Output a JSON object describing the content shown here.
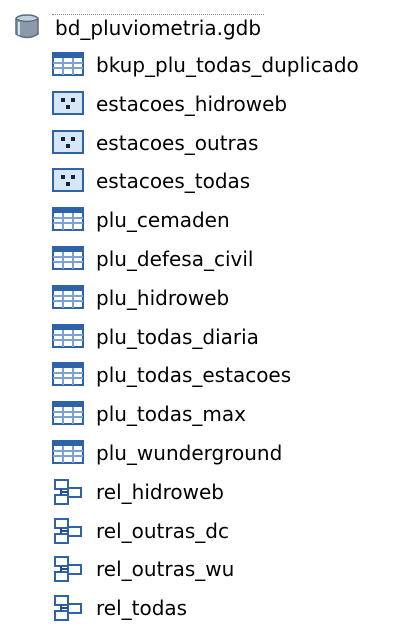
{
  "root": {
    "label": "bd_pluviometria.gdb",
    "icon": "database-icon"
  },
  "items": [
    {
      "label": "bkup_plu_todas_duplicado",
      "type": "table",
      "icon": "table-icon"
    },
    {
      "label": "estacoes_hidroweb",
      "type": "point-feature-class",
      "icon": "point-feature-class-icon"
    },
    {
      "label": "estacoes_outras",
      "type": "point-feature-class",
      "icon": "point-feature-class-icon"
    },
    {
      "label": "estacoes_todas",
      "type": "point-feature-class",
      "icon": "point-feature-class-icon"
    },
    {
      "label": "plu_cemaden",
      "type": "table",
      "icon": "table-icon"
    },
    {
      "label": "plu_defesa_civil",
      "type": "table",
      "icon": "table-icon"
    },
    {
      "label": "plu_hidroweb",
      "type": "table",
      "icon": "table-icon"
    },
    {
      "label": "plu_todas_diaria",
      "type": "table",
      "icon": "table-icon"
    },
    {
      "label": "plu_todas_estacoes",
      "type": "table",
      "icon": "table-icon"
    },
    {
      "label": "plu_todas_max",
      "type": "table",
      "icon": "table-icon"
    },
    {
      "label": "plu_wunderground",
      "type": "table",
      "icon": "table-icon"
    },
    {
      "label": "rel_hidroweb",
      "type": "relationship-class",
      "icon": "relationship-class-icon"
    },
    {
      "label": "rel_outras_dc",
      "type": "relationship-class",
      "icon": "relationship-class-icon"
    },
    {
      "label": "rel_outras_wu",
      "type": "relationship-class",
      "icon": "relationship-class-icon"
    },
    {
      "label": "rel_todas",
      "type": "relationship-class",
      "icon": "relationship-class-icon"
    }
  ],
  "colors": {
    "icon_blue": "#2e63a9",
    "icon_light": "#d7e6f7",
    "database_gray": "#6f7f90"
  }
}
